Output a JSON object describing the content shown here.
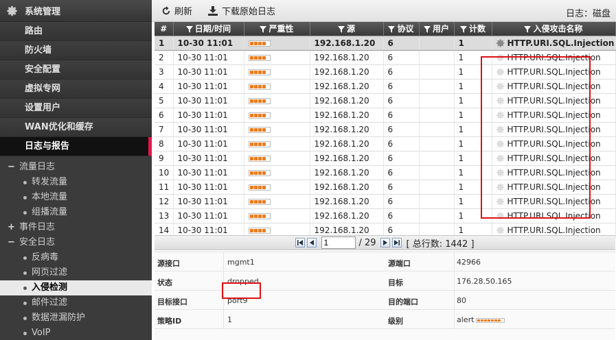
{
  "sidebar": {
    "header": "系统管理",
    "items": [
      {
        "label": "路由"
      },
      {
        "label": "防火墙"
      },
      {
        "label": "安全配置"
      },
      {
        "label": "虚拟专网"
      },
      {
        "label": "设置用户"
      },
      {
        "label": "WAN优化和缓存"
      },
      {
        "label": "日志与报告"
      }
    ],
    "tree": [
      {
        "symbol": "−",
        "label": "流量日志",
        "level": 1
      },
      {
        "symbol": "",
        "label": "转发流量",
        "level": 2
      },
      {
        "symbol": "",
        "label": "本地流量",
        "level": 2
      },
      {
        "symbol": "",
        "label": "组播流量",
        "level": 2
      },
      {
        "symbol": "+",
        "label": "事件日志",
        "level": 1
      },
      {
        "symbol": "−",
        "label": "安全日志",
        "level": 1
      },
      {
        "symbol": "",
        "label": "反病毒",
        "level": 2
      },
      {
        "symbol": "",
        "label": "网页过滤",
        "level": 2
      },
      {
        "symbol": "",
        "label": "入侵检测",
        "level": 2
      },
      {
        "symbol": "",
        "label": "邮件过滤",
        "level": 2
      },
      {
        "symbol": "",
        "label": "数据泄漏防护",
        "level": 2
      },
      {
        "symbol": "",
        "label": "VoIP",
        "level": 2
      }
    ]
  },
  "toolbar": {
    "refresh_label": "刷新",
    "download_label": "下载原始日志",
    "log_source": "日志：磁盘"
  },
  "table": {
    "columns": [
      "#",
      "日期/时间",
      "严重性",
      "源",
      "协议",
      "用户",
      "计数",
      "入侵攻击名称"
    ],
    "rows": [
      {
        "num": "1",
        "date": "10-30 11:01",
        "severity_level": 0.8,
        "src": "192.168.1.20",
        "proto": "6",
        "user": "",
        "count": "1",
        "attack": "HTTP.URI.SQL.Injection"
      },
      {
        "num": "2",
        "date": "10-30 11:01",
        "severity_level": 0.8,
        "src": "192.168.1.20",
        "proto": "6",
        "user": "",
        "count": "1",
        "attack": "HTTP.URI.SQL.Injection"
      },
      {
        "num": "3",
        "date": "10-30 11:01",
        "severity_level": 0.8,
        "src": "192.168.1.20",
        "proto": "6",
        "user": "",
        "count": "1",
        "attack": "HTTP.URI.SQL.Injection"
      },
      {
        "num": "4",
        "date": "10-30 11:01",
        "severity_level": 0.8,
        "src": "192.168.1.20",
        "proto": "6",
        "user": "",
        "count": "1",
        "attack": "HTTP.URI.SQL.Injection"
      },
      {
        "num": "5",
        "date": "10-30 11:01",
        "severity_level": 0.8,
        "src": "192.168.1.20",
        "proto": "6",
        "user": "",
        "count": "1",
        "attack": "HTTP.URI.SQL.Injection"
      },
      {
        "num": "6",
        "date": "10-30 11:01",
        "severity_level": 0.8,
        "src": "192.168.1.20",
        "proto": "6",
        "user": "",
        "count": "1",
        "attack": "HTTP.URI.SQL.Injection"
      },
      {
        "num": "7",
        "date": "10-30 11:01",
        "severity_level": 0.8,
        "src": "192.168.1.20",
        "proto": "6",
        "user": "",
        "count": "1",
        "attack": "HTTP.URI.SQL.Injection"
      },
      {
        "num": "8",
        "date": "10-30 11:01",
        "severity_level": 0.8,
        "src": "192.168.1.20",
        "proto": "6",
        "user": "",
        "count": "1",
        "attack": "HTTP.URI.SQL.Injection"
      },
      {
        "num": "9",
        "date": "10-30 11:01",
        "severity_level": 0.8,
        "src": "192.168.1.20",
        "proto": "6",
        "user": "",
        "count": "1",
        "attack": "HTTP.URI.SQL.Injection"
      },
      {
        "num": "10",
        "date": "10-30 11:01",
        "severity_level": 0.8,
        "src": "192.168.1.20",
        "proto": "6",
        "user": "",
        "count": "1",
        "attack": "HTTP.URI.SQL.Injection"
      },
      {
        "num": "11",
        "date": "10-30 11:01",
        "severity_level": 0.8,
        "src": "192.168.1.20",
        "proto": "6",
        "user": "",
        "count": "1",
        "attack": "HTTP.URI.SQL.Injection"
      },
      {
        "num": "12",
        "date": "10-30 11:01",
        "severity_level": 0.8,
        "src": "192.168.1.20",
        "proto": "6",
        "user": "",
        "count": "1",
        "attack": "HTTP.URI.SQL.Injection"
      },
      {
        "num": "13",
        "date": "10-30 11:01",
        "severity_level": 0.8,
        "src": "192.168.1.20",
        "proto": "6",
        "user": "",
        "count": "1",
        "attack": "HTTP.URI.SQL.Injection"
      },
      {
        "num": "14",
        "date": "10-30 11:01",
        "severity_level": 0.8,
        "src": "192.168.1.20",
        "proto": "6",
        "user": "",
        "count": "1",
        "attack": "HTTP.URI.SQL.Injection"
      }
    ]
  },
  "pager": {
    "page": "1",
    "total_pages": "/ 29",
    "total_rows": "[ 总行数: 1442 ]"
  },
  "details": [
    {
      "k1": "源接口",
      "v1": "mgmt1",
      "k2": "源端口",
      "v2": "42966"
    },
    {
      "k1": "状态",
      "v1": "dropped",
      "k2": "目标",
      "v2": "176.28.50.165"
    },
    {
      "k1": "目标接口",
      "v1": "port9",
      "k2": "目的端口",
      "v2": "80"
    },
    {
      "k1": "策略ID",
      "v1": "1",
      "k2": "级别",
      "v2": "alert"
    }
  ],
  "colors": {
    "sidebar_bg": "#3b3b3b",
    "active_marker": "#e0174c",
    "severity_bar": "#f07a1a",
    "highlight": "#dd1111"
  }
}
